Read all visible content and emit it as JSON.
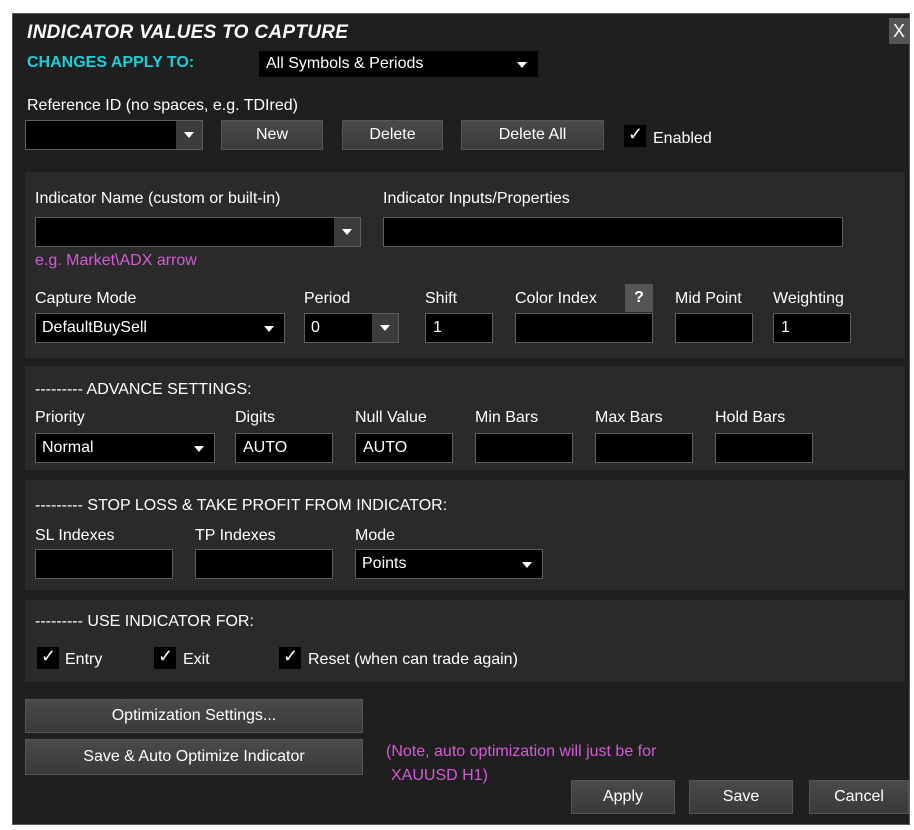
{
  "dialog": {
    "title": "INDICATOR VALUES TO CAPTURE",
    "close": "X",
    "changes_apply_label": "CHANGES APPLY TO:",
    "changes_apply_value": "All Symbols & Periods"
  },
  "reference": {
    "label": "Reference ID (no spaces, e.g. TDIred)",
    "value": "",
    "new_label": "New",
    "delete_label": "Delete",
    "delete_all_label": "Delete All",
    "enabled_label": "Enabled",
    "enabled_checked": true
  },
  "indicator": {
    "name_label": "Indicator Name (custom or built-in)",
    "inputs_label": "Indicator Inputs/Properties",
    "name_value": "",
    "inputs_value": "",
    "example": "e.g. Market\\ADX arrow",
    "capture_mode_label": "Capture Mode",
    "capture_mode_value": "DefaultBuySell",
    "period_label": "Period",
    "period_value": "0",
    "shift_label": "Shift",
    "shift_value": "1",
    "color_index_label": "Color Index",
    "color_index_help": "?",
    "color_index_value": "",
    "mid_point_label": "Mid Point",
    "mid_point_value": "",
    "weighting_label": "Weighting",
    "weighting_value": "1"
  },
  "advance": {
    "header": "--------- ADVANCE SETTINGS:",
    "priority_label": "Priority",
    "priority_value": "Normal",
    "digits_label": "Digits",
    "digits_value": "AUTO",
    "null_label": "Null Value",
    "null_value": "AUTO",
    "min_bars_label": "Min Bars",
    "min_bars_value": "",
    "max_bars_label": "Max Bars",
    "max_bars_value": "",
    "hold_bars_label": "Hold Bars",
    "hold_bars_value": ""
  },
  "sltp": {
    "header": "--------- STOP LOSS & TAKE PROFIT FROM INDICATOR:",
    "sl_label": "SL Indexes",
    "sl_value": "",
    "tp_label": "TP Indexes",
    "tp_value": "",
    "mode_label": "Mode",
    "mode_value": "Points"
  },
  "use_for": {
    "header": "--------- USE INDICATOR FOR:",
    "entry_label": "Entry",
    "exit_label": "Exit",
    "reset_label": "Reset (when can trade again)",
    "entry_checked": true,
    "exit_checked": true,
    "reset_checked": true
  },
  "footer": {
    "optimization_label": "Optimization Settings...",
    "save_optimize_label": "Save & Auto Optimize Indicator",
    "note_line1": "(Note, auto optimization will just be for",
    "note_line2": "XAUUSD H1)",
    "apply_label": "Apply",
    "save_label": "Save",
    "cancel_label": "Cancel"
  },
  "icons": {
    "check": "✓",
    "dropdown": "chevron-down-icon"
  },
  "colors": {
    "background": "#1f1f1f",
    "panel": "#2a2a2a",
    "accent_cyan": "#19d0d8",
    "hint_magenta": "#d65ad8"
  }
}
